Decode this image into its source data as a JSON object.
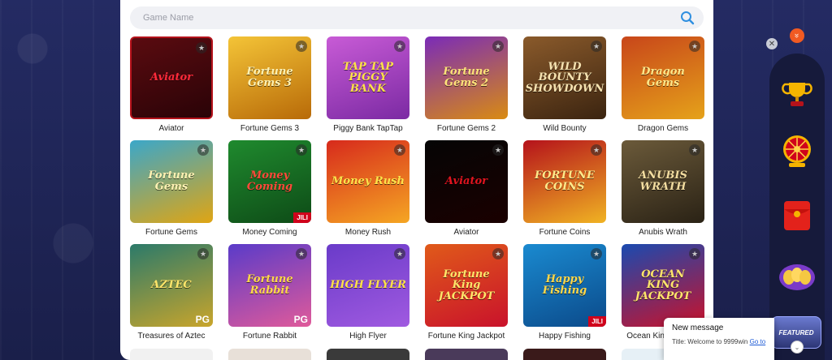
{
  "search": {
    "placeholder": "Game Name"
  },
  "games": [
    {
      "name": "Aviator",
      "logo": "Aviator",
      "bg": "linear-gradient(160deg,#5a0b10,#2a0307)",
      "logo_color": "#ff2a3a",
      "badge": ""
    },
    {
      "name": "Fortune Gems 3",
      "logo": "Fortune Gems 3",
      "bg": "linear-gradient(160deg,#f4c437,#b86a08)",
      "logo_color": "#fff2b3",
      "badge": ""
    },
    {
      "name": "Piggy Bank TapTap",
      "logo": "TAP TAP PIGGY BANK",
      "bg": "linear-gradient(160deg,#c85bd6,#7b2aa3)",
      "logo_color": "#ffe14a",
      "badge": ""
    },
    {
      "name": "Fortune Gems 2",
      "logo": "Fortune Gems 2",
      "bg": "linear-gradient(160deg,#7a2bb8,#d98b12)",
      "logo_color": "#ffe37a",
      "badge": ""
    },
    {
      "name": "Wild Bounty",
      "logo": "WILD BOUNTY SHOWDOWN",
      "bg": "linear-gradient(160deg,#8a5a2b,#3b2410)",
      "logo_color": "#f6e2b0",
      "badge": ""
    },
    {
      "name": "Dragon Gems",
      "logo": "Dragon Gems",
      "bg": "linear-gradient(160deg,#c8461a,#e5a21a)",
      "logo_color": "#ffe88a",
      "badge": ""
    },
    {
      "name": "Fortune Gems",
      "logo": "Fortune Gems",
      "bg": "linear-gradient(160deg,#3ba7c9,#e0a513)",
      "logo_color": "#fff2b3",
      "badge": ""
    },
    {
      "name": "Money Coming",
      "logo": "Money Coming",
      "bg": "linear-gradient(160deg,#1f8a2e,#0e4b17)",
      "logo_color": "#ff4a3a",
      "badge": "JILI"
    },
    {
      "name": "Money Rush",
      "logo": "Money Rush",
      "bg": "linear-gradient(160deg,#d72a1c,#f5a623)",
      "logo_color": "#ffe34a",
      "badge": ""
    },
    {
      "name": "Aviator",
      "logo": "Aviator",
      "bg": "linear-gradient(160deg,#050505,#1a0000)",
      "logo_color": "#e1141f",
      "badge": ""
    },
    {
      "name": "Fortune Coins",
      "logo": "FORTUNE COINS",
      "bg": "linear-gradient(160deg,#b5121b,#f0b323)",
      "logo_color": "#ffe98a",
      "badge": ""
    },
    {
      "name": "Anubis Wrath",
      "logo": "ANUBIS WRATH",
      "bg": "linear-gradient(160deg,#6b5a3a,#2a2215)",
      "logo_color": "#f3dda0",
      "badge": ""
    },
    {
      "name": "Treasures of Aztec",
      "logo": "AZTEC",
      "bg": "linear-gradient(160deg,#2b7a6a,#c9a52b)",
      "logo_color": "#ffe56a",
      "badge": "PG"
    },
    {
      "name": "Fortune Rabbit",
      "logo": "Fortune Rabbit",
      "bg": "linear-gradient(160deg,#5a3bc9,#e05a9a)",
      "logo_color": "#ffd84a",
      "badge": "PG"
    },
    {
      "name": "High Flyer",
      "logo": "HIGH FLYER",
      "bg": "linear-gradient(160deg,#6a3bc9,#a05ae0)",
      "logo_color": "#ffe14a",
      "badge": ""
    },
    {
      "name": "Fortune King Jackpot",
      "logo": "Fortune King JACKPOT",
      "bg": "linear-gradient(160deg,#e05a1a,#c9122b)",
      "logo_color": "#ffe56a",
      "badge": ""
    },
    {
      "name": "Happy Fishing",
      "logo": "Happy Fishing",
      "bg": "linear-gradient(160deg,#1a8ad0,#0b4a8a)",
      "logo_color": "#ffd84a",
      "badge": "JILI"
    },
    {
      "name": "Ocean King Jackpot",
      "logo": "OCEAN KING JACKPOT",
      "bg": "linear-gradient(160deg,#1a4ab0,#c9122b)",
      "logo_color": "#ffe56a",
      "badge": ""
    }
  ],
  "next_row_colors": [
    "#f1f1f1",
    "#e8e0d8",
    "#3a3a3a",
    "#4a3a5a",
    "#3a1a1a",
    "#e6f0f6"
  ],
  "dock": {
    "close_glyph": "✕",
    "collapse_glyph": "»",
    "featured_label": "FEATURED"
  },
  "toast": {
    "title": "New message",
    "body": "Title: Welcome to 9999win",
    "link": "Go to"
  }
}
